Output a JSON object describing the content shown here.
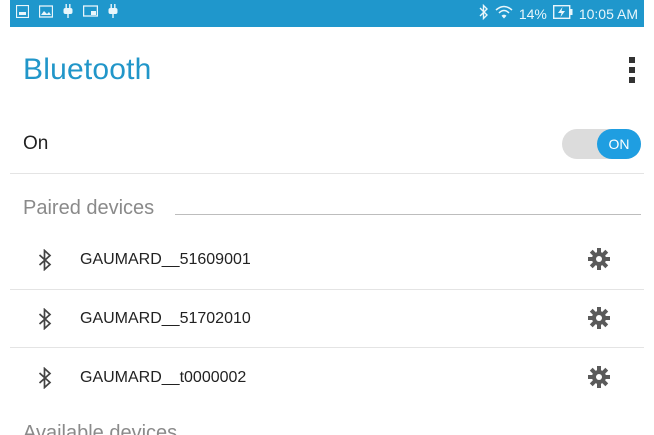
{
  "status_bar": {
    "battery": "14%",
    "time": "10:05 AM",
    "icons": [
      "picture-icon",
      "image-icon",
      "plug-icon",
      "cast-icon",
      "plug-icon",
      "bluetooth-icon",
      "wifi-icon",
      "battery-charging-icon"
    ]
  },
  "header": {
    "title": "Bluetooth",
    "overflow_icon": "overflow-menu-icon"
  },
  "toggle": {
    "label": "On",
    "state": "ON"
  },
  "paired": {
    "title": "Paired devices",
    "devices": [
      {
        "name": "GAUMARD__51609001"
      },
      {
        "name": "GAUMARD__51702010"
      },
      {
        "name": "GAUMARD__t0000002"
      }
    ]
  },
  "available": {
    "title": "Available devices"
  },
  "colors": {
    "accent": "#2196c9",
    "status_bar": "#1f97cc",
    "switch_on": "#1f9ee1"
  }
}
